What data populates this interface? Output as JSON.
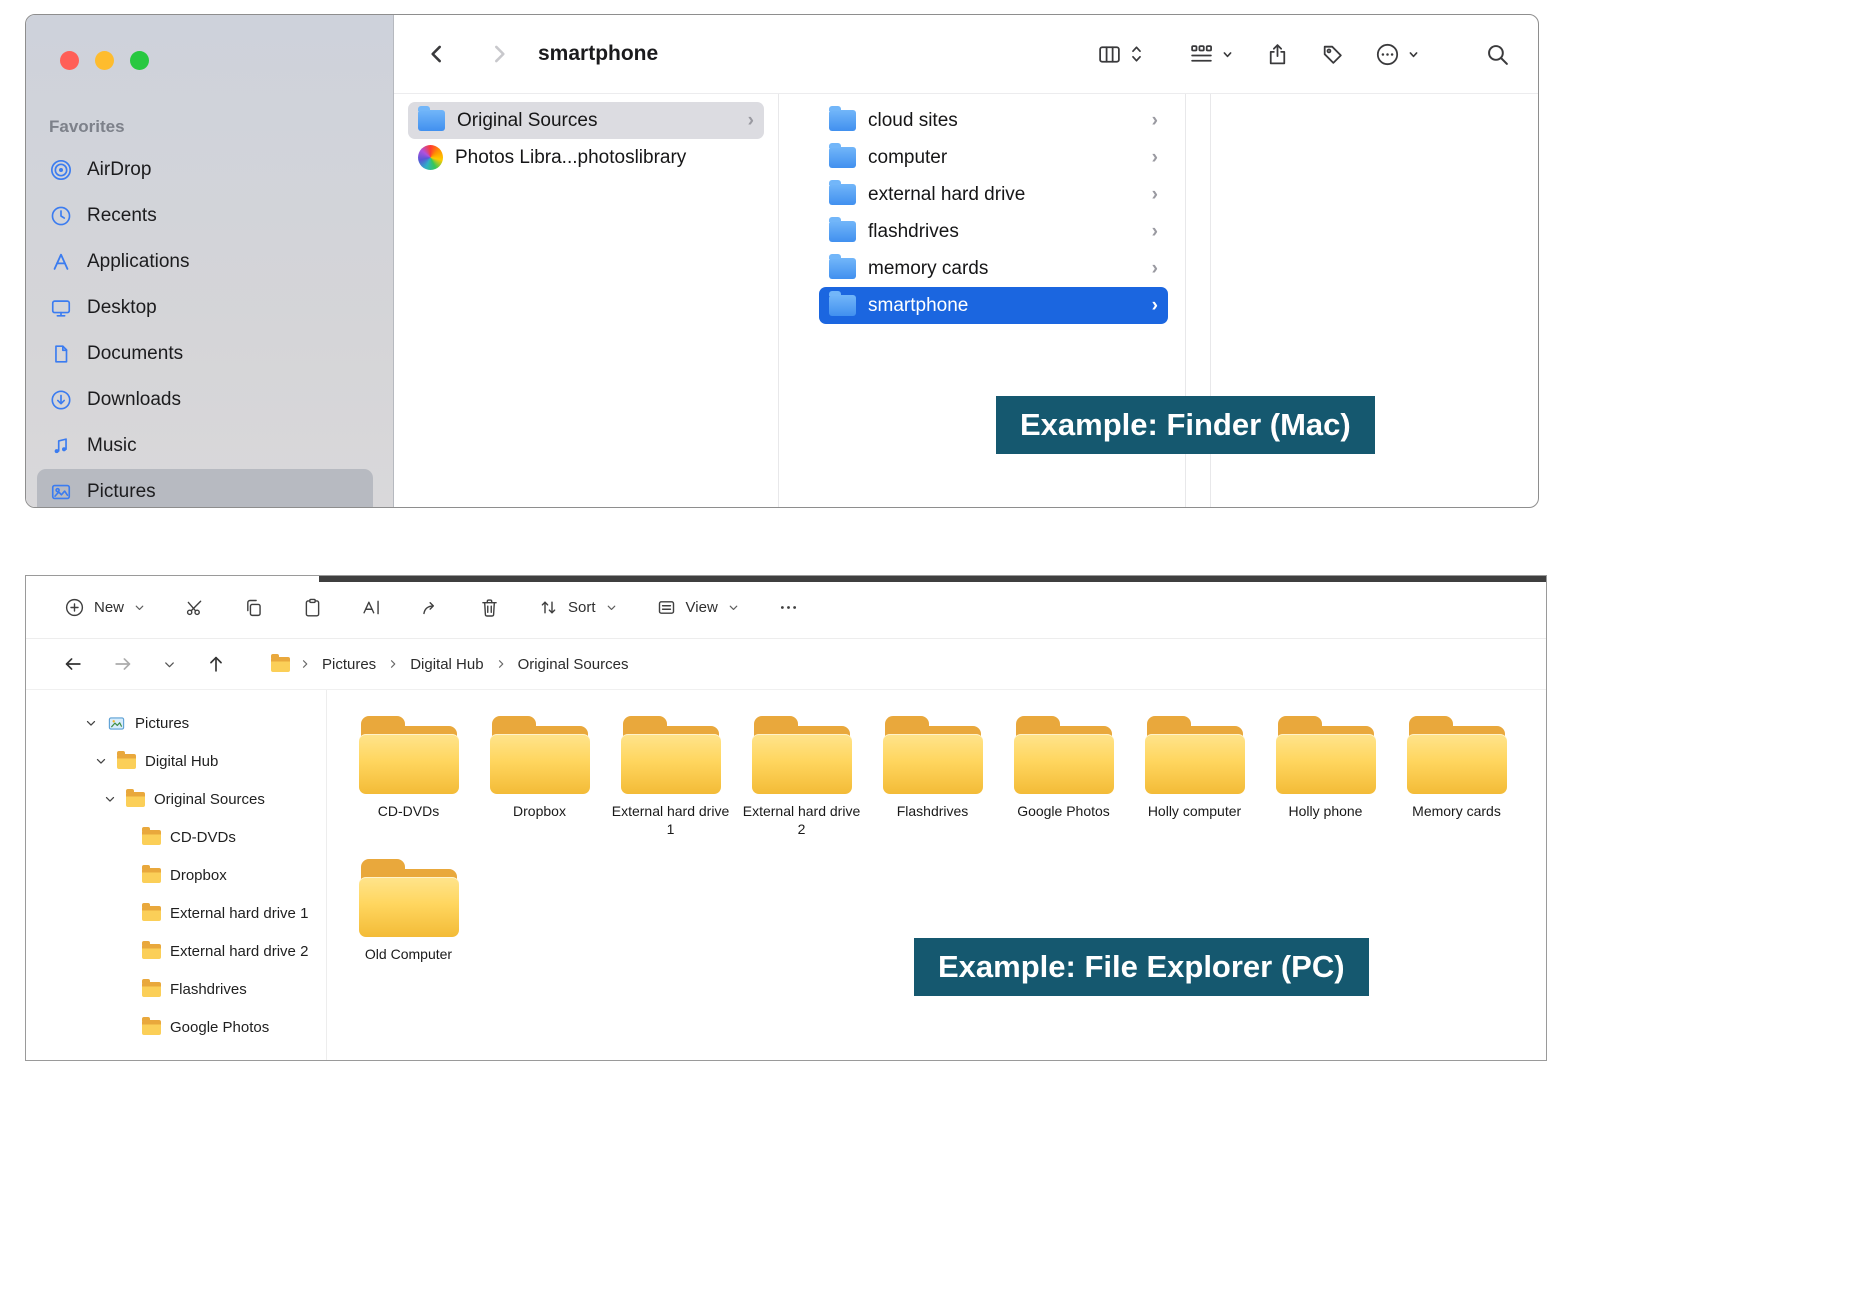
{
  "finder": {
    "title": "smartphone",
    "sidebar": {
      "section_label": "Favorites",
      "items": [
        {
          "label": "AirDrop"
        },
        {
          "label": "Recents"
        },
        {
          "label": "Applications"
        },
        {
          "label": "Desktop"
        },
        {
          "label": "Documents"
        },
        {
          "label": "Downloads"
        },
        {
          "label": "Music"
        },
        {
          "label": "Pictures",
          "selected": true
        }
      ]
    },
    "column1": {
      "items": [
        {
          "label": "Original Sources",
          "selected": true
        },
        {
          "label": "Photos Libra...photoslibrary"
        }
      ]
    },
    "column2": {
      "items": [
        {
          "label": "cloud sites"
        },
        {
          "label": "computer"
        },
        {
          "label": "external hard drive"
        },
        {
          "label": "flashdrives"
        },
        {
          "label": "memory cards"
        },
        {
          "label": "smartphone",
          "selected": true
        }
      ]
    },
    "caption": "Example: Finder (Mac)"
  },
  "explorer": {
    "toolbar": {
      "new_label": "New",
      "sort_label": "Sort",
      "view_label": "View"
    },
    "breadcrumb": {
      "items": [
        "Pictures",
        "Digital Hub",
        "Original Sources"
      ]
    },
    "tree": {
      "items": [
        {
          "label": "Pictures",
          "expanded": true
        },
        {
          "label": "Digital Hub",
          "expanded": true
        },
        {
          "label": "Original Sources",
          "expanded": true
        },
        {
          "label": "CD-DVDs"
        },
        {
          "label": "Dropbox"
        },
        {
          "label": "External hard drive 1"
        },
        {
          "label": "External hard drive 2"
        },
        {
          "label": "Flashdrives"
        },
        {
          "label": "Google Photos"
        }
      ]
    },
    "folders": [
      {
        "label": "CD-DVDs"
      },
      {
        "label": "Dropbox"
      },
      {
        "label": "External hard drive 1"
      },
      {
        "label": "External hard drive 2"
      },
      {
        "label": "Flashdrives"
      },
      {
        "label": "Google Photos"
      },
      {
        "label": "Holly computer"
      },
      {
        "label": "Holly phone"
      },
      {
        "label": "Memory cards"
      },
      {
        "label": "Old Computer"
      }
    ],
    "caption": "Example: File Explorer (PC)"
  },
  "colors": {
    "selection-blue": "#1b66e0",
    "caption-bg": "#15586f",
    "mac-icon-blue": "#3b7cf0",
    "mac-folder-blue": "#4f9cf3",
    "win-folder-front": "#ffd65f",
    "win-folder-back": "#e9a83c"
  }
}
